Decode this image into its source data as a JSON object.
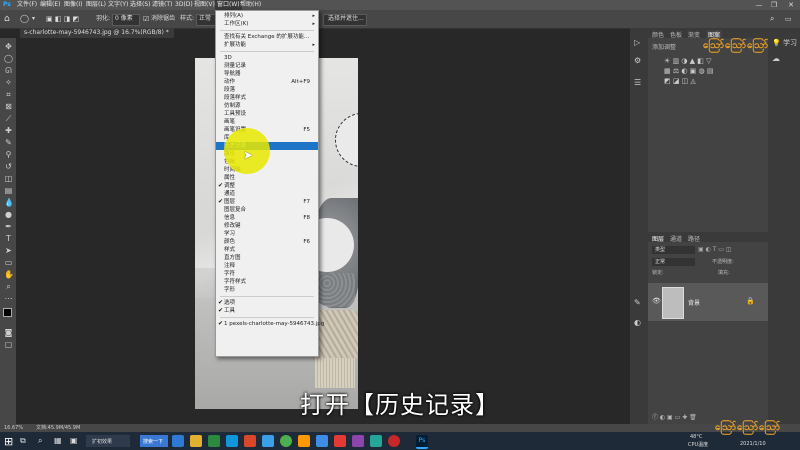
{
  "menubar": {
    "items": [
      "文件(F)",
      "编辑(E)",
      "图像(I)",
      "图层(L)",
      "文字(Y)",
      "选择(S)",
      "滤镜(T)",
      "3D(D)",
      "视图(V)",
      "窗口(W)",
      "帮助(H)"
    ]
  },
  "options": {
    "feather_label": "羽化:",
    "feather_value": "0 像素",
    "antialias_label": "消除锯齿",
    "style_label": "样式:",
    "style_value": "正常",
    "select_mask": "选择并遮住..."
  },
  "document": {
    "tab_title": "s-charlotte-may-5946743.jpg @ 16.7%(RGB/8) *"
  },
  "menu": {
    "items": [
      {
        "label": "排列(A)",
        "arrow": "▸"
      },
      {
        "label": "工作区(K)",
        "arrow": "▸"
      },
      {
        "sep": true
      },
      {
        "label": "查找有关 Exchange 的扩展功能..."
      },
      {
        "label": "扩展功能",
        "arrow": "▸"
      },
      {
        "sep": true
      },
      {
        "label": "3D"
      },
      {
        "label": "测量记录"
      },
      {
        "label": "导航器"
      },
      {
        "label": "动作",
        "shortcut": "Alt+F9"
      },
      {
        "label": "段落"
      },
      {
        "label": "段落样式"
      },
      {
        "label": "仿制源"
      },
      {
        "label": "工具预设"
      },
      {
        "label": "画笔"
      },
      {
        "label": "画笔设置",
        "shortcut": "F5"
      },
      {
        "label": "库"
      },
      {
        "label": "历史记录",
        "highlight": true
      },
      {
        "label": "路径"
      },
      {
        "label": "色板"
      },
      {
        "label": "时间轴"
      },
      {
        "label": "属性"
      },
      {
        "label": "调整",
        "check": "✔"
      },
      {
        "label": "通道"
      },
      {
        "label": "图层",
        "check": "✔",
        "shortcut": "F7"
      },
      {
        "label": "图层复合"
      },
      {
        "label": "信息",
        "shortcut": "F8"
      },
      {
        "label": "修改键"
      },
      {
        "label": "学习"
      },
      {
        "label": "颜色",
        "shortcut": "F6"
      },
      {
        "label": "样式"
      },
      {
        "label": "直方图"
      },
      {
        "label": "注释"
      },
      {
        "label": "字符"
      },
      {
        "label": "字符样式"
      },
      {
        "label": "字形"
      },
      {
        "sep": true
      },
      {
        "label": "选项",
        "check": "✔"
      },
      {
        "label": "工具",
        "check": "✔"
      },
      {
        "sep": true
      },
      {
        "label": "1 pexels-charlotte-may-5946743.jpg",
        "check": "✔"
      }
    ]
  },
  "panels": {
    "top_tabs": [
      "颜色",
      "色板",
      "渐变",
      "图案"
    ],
    "add_adjust": "添加调整",
    "learn_label": "学习",
    "layers_tabs": [
      "图层",
      "通道",
      "路径"
    ],
    "kind_label": "类型",
    "blend_mode": "正常",
    "opacity_label": "不透明度:",
    "lock_label": "锁定:",
    "fill_label": "填充:",
    "layer_name": "背景"
  },
  "subtitle": "打开【历史记录】",
  "status": {
    "zoom": "16.67%",
    "doc_info": "文档:45.9M/45.9M"
  },
  "taskbar": {
    "search_text": "扩初效果",
    "input_text": "搜索一下",
    "weather": "48°C",
    "cpu": "CPU温度",
    "date": "2021/1/10"
  },
  "colors": {
    "menu_highlight": "#1e74c7",
    "cursor_circle": "#e8e800"
  }
}
